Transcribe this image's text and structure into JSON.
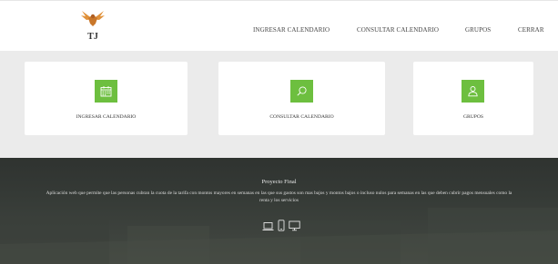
{
  "header": {
    "logo_text": "TJ",
    "nav": [
      {
        "label": "INGRESAR CALENDARIO"
      },
      {
        "label": "CONSULTAR CALENDARIO"
      },
      {
        "label": "GRUPOS"
      },
      {
        "label": "CERRAR"
      }
    ]
  },
  "cards": [
    {
      "label": "INGRESAR CALENDARIO",
      "icon": "calendar-icon"
    },
    {
      "label": "CONSULTAR CALENDARIO",
      "icon": "search-icon"
    },
    {
      "label": "GRUPOS",
      "icon": "user-icon"
    }
  ],
  "footer": {
    "title": "Proyecto Final",
    "description": "Aplicación web que permite que las personas cubran la cuota de la tarifa con montos mayores en semanas en las que sus gastos son mas bajos y montos bajos o incluso nulos para semanas en las que deben cubrir pagos mensuales como la renta y los servicios",
    "device_icons": [
      "laptop-icon",
      "phone-icon",
      "monitor-icon"
    ]
  },
  "colors": {
    "accent": "#6dbf3f",
    "logo_orange": "#e0913a",
    "band_gray": "#ebebeb",
    "footer_dark": "#353a36"
  }
}
